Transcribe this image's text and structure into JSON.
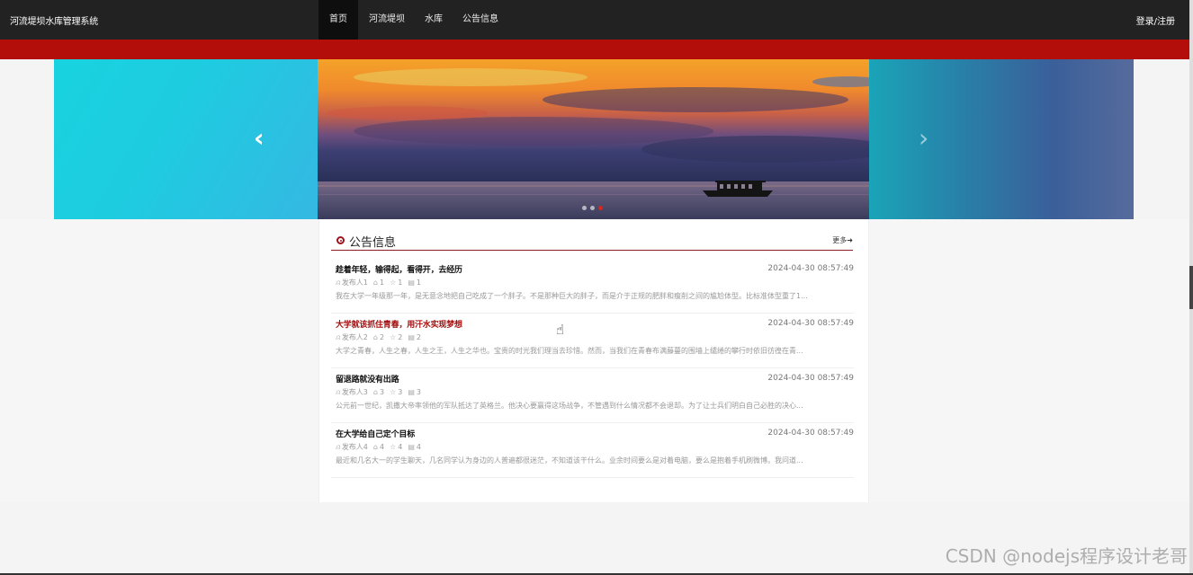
{
  "header": {
    "brand": "河流堤坝水库管理系统",
    "nav": [
      "首页",
      "河流堤坝",
      "水库",
      "公告信息"
    ],
    "active_nav": 0,
    "login": "登录/注册"
  },
  "carousel": {
    "prev_icon": "chevron-left-icon",
    "next_icon": "chevron-right-icon",
    "dots": 3,
    "active_dot": 2
  },
  "notices": {
    "title": "公告信息",
    "more": "更多➜",
    "items": [
      {
        "title": "趁着年轻，输得起，看得开，去经历",
        "date": "2024-04-30 08:57:49",
        "author": "发布人1",
        "likes": "1",
        "favorites": "1",
        "comments": "1",
        "excerpt": "我在大学一年级那一年，是无意念地把自己吃成了一个胖子。不是那种巨大的胖子，而是介于正规的肥胖和瘦削之间的尴尬体型。比标准体型重了1..."
      },
      {
        "title": "大学就该抓住青春，用汗水实现梦想",
        "date": "2024-04-30 08:57:49",
        "author": "发布人2",
        "likes": "2",
        "favorites": "2",
        "comments": "2",
        "excerpt": "大学之青春，人生之春，人生之王，人生之华也。宝贵的时光我们理当去珍惜。然而，当我们在青春布满藤蔓的围墙上缱绻的攀行时依旧彷徨在青..."
      },
      {
        "title": "留退路就没有出路",
        "date": "2024-04-30 08:57:49",
        "author": "发布人3",
        "likes": "3",
        "favorites": "3",
        "comments": "3",
        "excerpt": "公元前一世纪，凯撒大帝率领他的军队抵达了英格兰。他决心要赢得这场战争，不管遇到什么情况都不会退却。为了让士兵们明白自己必胜的决心..."
      },
      {
        "title": "在大学给自己定个目标",
        "date": "2024-04-30 08:57:49",
        "author": "发布人4",
        "likes": "4",
        "favorites": "4",
        "comments": "4",
        "excerpt": "最近和几名大一的学生聊天，几名同学认为身边的人普遍都很迷茫，不知道该干什么。业余时间要么是对着电脑，要么是抱着手机刷微博。我问道..."
      }
    ]
  },
  "watermark": "CSDN @nodejs程序设计老哥",
  "colors": {
    "nav_bg": "#222222",
    "accent_red": "#b30e0a",
    "highlight_title": "#a30f0f"
  }
}
